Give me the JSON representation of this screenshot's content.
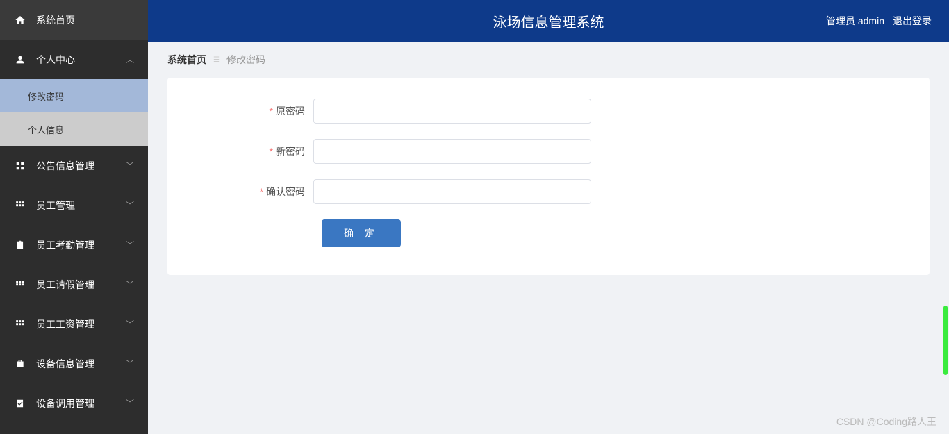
{
  "header": {
    "title": "泳场信息管理系统",
    "user_label": "管理员 admin",
    "logout_label": "退出登录"
  },
  "breadcrumb": {
    "home": "系统首页",
    "current": "修改密码"
  },
  "sidebar": {
    "items": [
      {
        "label": "系统首页",
        "icon": "home"
      },
      {
        "label": "个人中心",
        "icon": "user",
        "expanded": true,
        "children": [
          {
            "label": "修改密码",
            "active": true
          },
          {
            "label": "个人信息",
            "active": false
          }
        ]
      },
      {
        "label": "公告信息管理",
        "icon": "grid"
      },
      {
        "label": "员工管理",
        "icon": "grid2"
      },
      {
        "label": "员工考勤管理",
        "icon": "clipboard"
      },
      {
        "label": "员工请假管理",
        "icon": "grid2"
      },
      {
        "label": "员工工资管理",
        "icon": "grid2"
      },
      {
        "label": "设备信息管理",
        "icon": "briefcase"
      },
      {
        "label": "设备调用管理",
        "icon": "checklist"
      }
    ]
  },
  "form": {
    "old_password_label": "原密码",
    "new_password_label": "新密码",
    "confirm_password_label": "确认密码",
    "old_password_value": "",
    "new_password_value": "",
    "confirm_password_value": "",
    "submit_label": "确 定"
  },
  "watermark": "CSDN @Coding路人王"
}
